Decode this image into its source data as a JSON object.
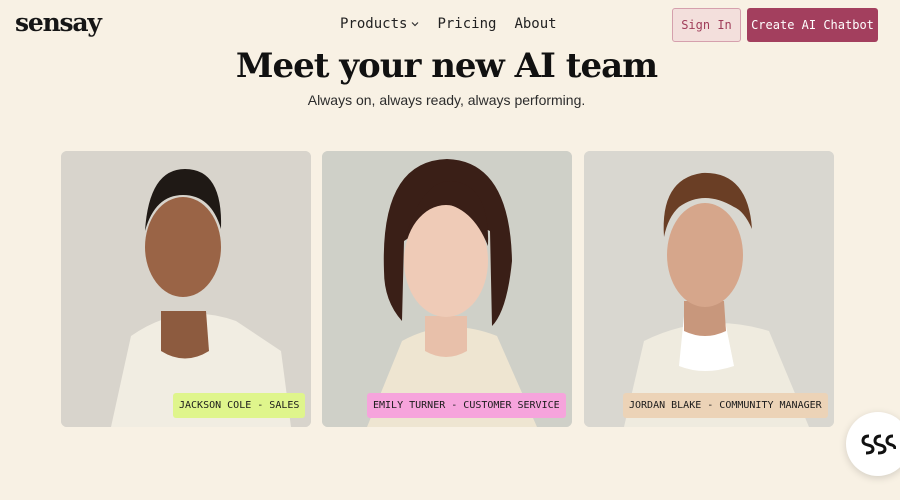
{
  "header": {
    "logo": "sensay",
    "nav": [
      {
        "label": "Products",
        "icon": "chevron-down-icon"
      },
      {
        "label": "Pricing"
      },
      {
        "label": "About"
      }
    ],
    "sign_in": "Sign In",
    "create": "Create AI Chatbot"
  },
  "hero": {
    "title": "Meet your new AI team",
    "subtitle": "Always on, always ready, always performing."
  },
  "team": [
    {
      "tag": "JACKSON COLE - SALES",
      "tag_color": "#dff58c"
    },
    {
      "tag": "EMILY TURNER - CUSTOMER SERVICE",
      "tag_color": "#f6a4dc"
    },
    {
      "tag": "JORDAN BLAKE - COMMUNITY MANAGER",
      "tag_color": "#ecd3b7"
    }
  ],
  "colors": {
    "background": "#f8f1e4",
    "accent": "#a33f5e",
    "signin_bg": "#f3dfdc"
  },
  "chat_widget": {
    "icon": "chat-logo-icon"
  }
}
